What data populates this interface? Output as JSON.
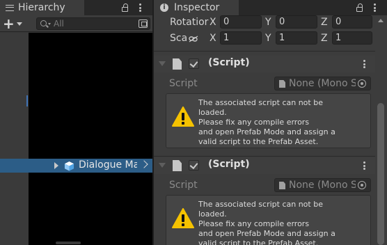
{
  "hierarchy": {
    "tab_label": "Hierarchy",
    "search_placeholder": "All",
    "add_button": "+",
    "selected_row_label": "Dialogue Ma"
  },
  "inspector": {
    "tab_label": "Inspector",
    "info_glyph": "i",
    "transform": {
      "rotation_label": "Rotatior",
      "rotation": {
        "x_label": "X",
        "x": "0",
        "y_label": "Y",
        "y": "0",
        "z_label": "Z",
        "z": "0"
      },
      "scale_label": "Sca",
      "scale": {
        "x_label": "X",
        "x": "1",
        "y_label": "Y",
        "y": "1",
        "z_label": "Z",
        "z": "1"
      }
    },
    "components": [
      {
        "title": "(Script)",
        "script_label": "Script",
        "script_value": "None (Mono S",
        "help_lines": [
          "The associated script can not be",
          "loaded.",
          "Please fix any compile errors",
          "and open Prefab Mode and assign a",
          "valid script to the Prefab Asset."
        ]
      },
      {
        "title": "(Script)",
        "script_label": "Script",
        "script_value": "None (Mono S",
        "help_lines": [
          "The associated script can not be",
          "loaded.",
          "Please fix any compile errors",
          "and open Prefab Mode and assign a",
          "valid script to the Prefab Asset."
        ]
      }
    ]
  },
  "colors": {
    "panel_bg": "#383838",
    "inspector_bg": "#3c3c3c",
    "selection": "#2c5d87",
    "warning": "#f5c200"
  },
  "icons": [
    "hamburger-menu-icon",
    "lock-icon",
    "kebab-menu-icon",
    "search-icon",
    "scene-filter-icon",
    "prefab-cube-icon",
    "chevron-right-icon",
    "info-icon",
    "link-icon",
    "script-file-icon",
    "object-picker-icon",
    "warning-icon"
  ]
}
